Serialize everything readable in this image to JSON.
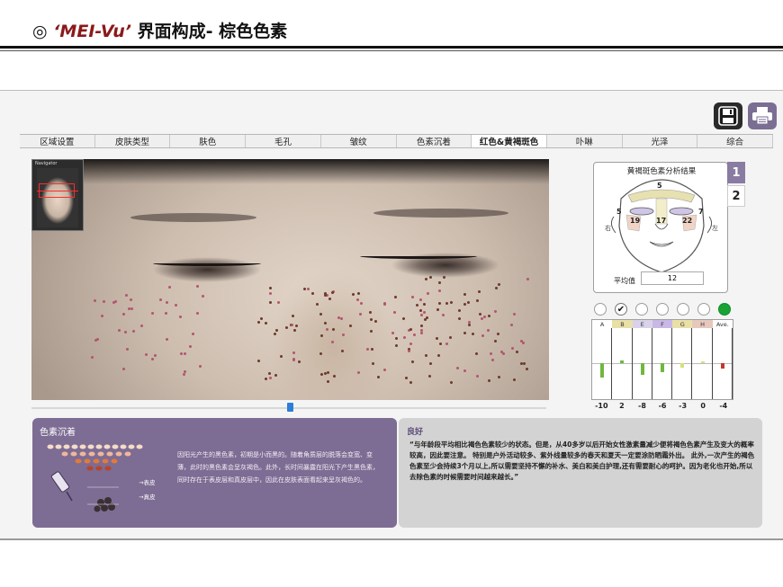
{
  "slide": {
    "symbol": "◎",
    "brand": "‘MEI-Vu’",
    "title_rest": " 界面构成- 棕色色素"
  },
  "toolbar": {
    "save_icon": "floppy-disk-icon",
    "print_icon": "printer-icon"
  },
  "tabs": [
    {
      "label": "区域设置"
    },
    {
      "label": "皮肤类型"
    },
    {
      "label": "肤色"
    },
    {
      "label": "毛孔"
    },
    {
      "label": "皱纹"
    },
    {
      "label": "色素沉着"
    },
    {
      "label": "红色&黄褐斑色",
      "active": true
    },
    {
      "label": "卟啉"
    },
    {
      "label": "光泽"
    },
    {
      "label": "综合"
    }
  ],
  "navigator": {
    "label": "Navigator"
  },
  "diagram": {
    "title": "黄褐斑色素分析结果",
    "zones": {
      "a": "5",
      "b": "5",
      "c": "7",
      "d": "19",
      "e": "17",
      "f": "22"
    },
    "side_right": "右",
    "side_left": "左",
    "avg_label": "平均值",
    "avg_value": "12"
  },
  "pages": [
    "1",
    "2"
  ],
  "radios": [
    "",
    "✔",
    "",
    "",
    "",
    "",
    ""
  ],
  "bar_chart": {
    "columns": [
      {
        "head": "A",
        "value": "-10"
      },
      {
        "head": "B",
        "value": "2"
      },
      {
        "head": "E",
        "value": "-8"
      },
      {
        "head": "F",
        "value": "-6"
      },
      {
        "head": "G",
        "value": "-3"
      },
      {
        "head": "H",
        "value": "0"
      },
      {
        "head": "Ave.",
        "value": "-4"
      }
    ],
    "head_colors": [
      "#ffffff",
      "#e9e0a8",
      "#d9d2ea",
      "#c9b8e6",
      "#e9e0a8",
      "#e7c8bd",
      "#ffffff"
    ],
    "mark_colors": [
      "#6fb83f",
      "#6fb83f",
      "#6fb83f",
      "#6fb83f",
      "#d7e07a",
      "#d7e07a",
      "#c0392b"
    ]
  },
  "panel_left": {
    "title": "色素沉着",
    "body": "因阳光产生的黑色素，初期是小而黑的。随着角质层的脱落会变宽、变薄，此时的黑色素会呈灰褐色。此外，长时间暴露在阳光下产生黑色素，同时存在于表皮层和真皮层中，因此在皮肤表面看起来呈灰褐色的。",
    "label_epidermis": "→表皮",
    "label_dermis": "→真皮"
  },
  "panel_right": {
    "title": "良好",
    "body": "“与年龄段平均相比褐色色素较少的状态。但是，从40多岁以后开始女性激素量减少便将褐色色素产生及变大的概率较高，因此要注意。 特别是户外活动较多、紫外线量较多的春天和夏天一定要涂防晒霜外出。 此外,一次产生的褐色色素至少会持续3个月以上,所以需要坚持不懈的补水、美白和美白护理,还有需要耐心的呵护。因为老化也开始,所以去除色素的时候需要时间越来越长。”"
  }
}
